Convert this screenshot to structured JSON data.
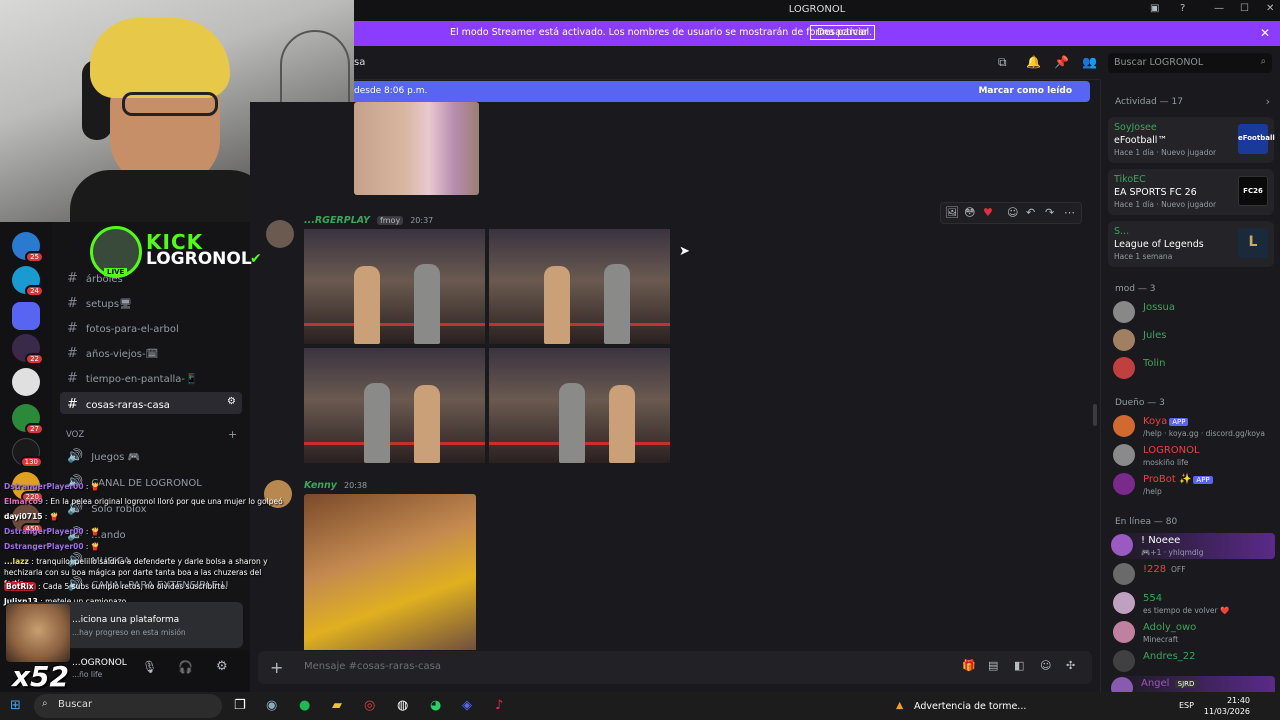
{
  "window": {
    "title": "LOGRONOL"
  },
  "streamer_banner": {
    "message": "El modo Streamer está activado. Los nombres de usuario se mostrarán de forma parcial.",
    "button": "Desactivar"
  },
  "channel_header": {
    "name": "sa"
  },
  "search": {
    "placeholder": "Buscar LOGRONOL"
  },
  "new_messages_bar": {
    "left": "desde 8:06 p.m.",
    "right": "Marcar como leído"
  },
  "messages": [
    {
      "author": "...RGERPLAY",
      "tag": "fmoy",
      "time": "20:37",
      "author_color": "#3ba55d"
    },
    {
      "author": "Kenny",
      "time": "20:38",
      "author_color": "#3ba55d"
    }
  ],
  "composer": {
    "placeholder": "Mensaje #cosas-raras-casa"
  },
  "channels": {
    "items": [
      "árboles",
      "setups🖥",
      "fotos-para-el-arbol",
      "años-viejos-🗓",
      "tiempo-en-pantalla-📱",
      "cosas-raras-casa"
    ],
    "voice_header": "VOZ",
    "voice": [
      "Juegos 🎮",
      "CANAL DE LOGRONOL",
      "Solo roblox",
      "...ando",
      "MUSICA",
      "CANAL PARA EXTENSIBLE U"
    ]
  },
  "guild_badges": [
    "25",
    "24",
    "22",
    "27",
    "130",
    "220",
    "450"
  ],
  "kick_overlay": {
    "brand": "KICK",
    "name": "LOGRONOL",
    "live": "LIVE"
  },
  "stream_chat": [
    {
      "user": "DstrangerPlayer00",
      "text": " : 🍟"
    },
    {
      "user": "Elmarco9",
      "text": " : En la pelea original logronol lloró por que una mujer lo golpeó"
    },
    {
      "user": "dayi0715",
      "text": " : 🍟"
    },
    {
      "user": "DstrangerPlayer00",
      "text": " : 🍟"
    },
    {
      "user": "DstrangerPlayer00",
      "text": " : 🍟"
    },
    {
      "user": "...lazz",
      "text": " : tranquilo, pelillo saldría a defenderte y darle bolsa a sharon y hechizarla con su boa mágica por darte tanta boa a las chuzeras del fortín"
    },
    {
      "user": "BotRix",
      "text": " : Cada 5 subs cumplo retos, no olvides suscribirte."
    },
    {
      "user": "Julixn13",
      "text": " : metele un camionazo"
    }
  ],
  "popup": {
    "title": "...iciona una plataforma",
    "subtitle": "...hay progreso en esta misión"
  },
  "user_panel": {
    "name": "...OGRONOL",
    "status": "...ño life"
  },
  "multiplier": "x52",
  "members": {
    "activity_header": "Actividad — 17",
    "activities": [
      {
        "user": "SoyJosee",
        "game": "eFootball™",
        "since": "Hace 1 día",
        "note": "Nuevo jugador",
        "logo": "eFootball",
        "logo_bg": "#1a3a9a"
      },
      {
        "user": "TikoEC",
        "game": "EA SPORTS FC 26",
        "since": "Hace 1 día",
        "note": "Nuevo jugador",
        "logo": "FC26",
        "logo_bg": "#0a0a0a"
      },
      {
        "user": "S...",
        "game": "League of Legends",
        "since": "Hace 1 semana",
        "note": "",
        "logo": "L",
        "logo_bg": "#1a2a3a"
      }
    ],
    "mod_header": "mod — 3",
    "mods": [
      "Jossua",
      "Jules",
      "Tolin"
    ],
    "owner_header": "Dueño — 3",
    "owners": [
      {
        "name": "Koya",
        "status": "/help · koya.gg · discord.gg/koya",
        "app": "APP",
        "color": "#f23f43"
      },
      {
        "name": "LOGRONOL",
        "status": "moskiño life",
        "app": "",
        "color": "#f23f43"
      },
      {
        "name": "ProBot ✨",
        "status": "/help",
        "app": "APP",
        "color": "#f23f43"
      }
    ],
    "online_header": "En línea — 80",
    "online": [
      {
        "name": "! Noeee",
        "status": "🎮+1 · yhlqmdlg",
        "color": "#3ba55d"
      },
      {
        "name": "!228",
        "status": "OFF",
        "color": "#f23f43"
      },
      {
        "name": "554",
        "status": "es tiempo de volver ❤️",
        "color": "#3ba55d"
      },
      {
        "name": "Adoly_owo",
        "status": "Minecraft",
        "color": "#3ba55d"
      },
      {
        "name": "Andres_22",
        "status": "",
        "color": "#3ba55d"
      },
      {
        "name": "Angel",
        "status": "SJRD",
        "color": "#9b59b6"
      }
    ]
  },
  "taskbar": {
    "search": "Buscar",
    "notification": "Advertencia de torme...",
    "lang": "ESP",
    "time": "21:40",
    "date": "11/03/2026"
  },
  "colors": {
    "accent": "#5865f2",
    "banner": "#8b3dff",
    "kick": "#53fc18",
    "online": "#3ba55d"
  }
}
